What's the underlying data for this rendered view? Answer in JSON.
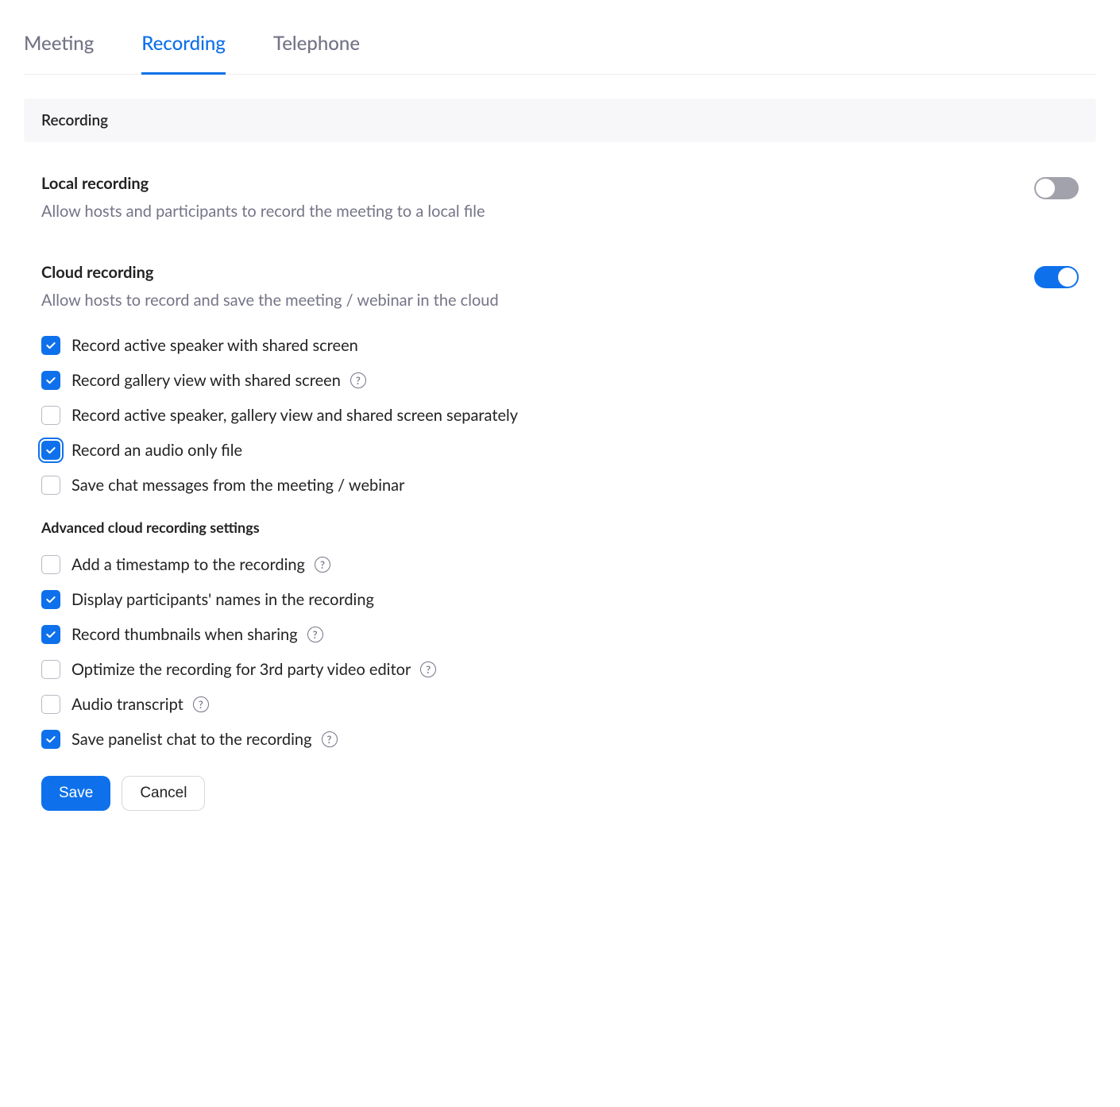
{
  "tabs": {
    "meeting": "Meeting",
    "recording": "Recording",
    "telephone": "Telephone"
  },
  "section_title": "Recording",
  "local": {
    "title": "Local recording",
    "desc": "Allow hosts and participants to record the meeting to a local file",
    "enabled": false
  },
  "cloud": {
    "title": "Cloud recording",
    "desc": "Allow hosts to record and save the meeting / webinar in the cloud",
    "enabled": true,
    "options": [
      {
        "label": "Record active speaker with shared screen",
        "checked": true,
        "help": false,
        "focus": false
      },
      {
        "label": "Record gallery view with shared screen",
        "checked": true,
        "help": true,
        "focus": false
      },
      {
        "label": "Record active speaker, gallery view and shared screen separately",
        "checked": false,
        "help": false,
        "focus": false
      },
      {
        "label": "Record an audio only file",
        "checked": true,
        "help": false,
        "focus": true
      },
      {
        "label": "Save chat messages from the meeting / webinar",
        "checked": false,
        "help": false,
        "focus": false
      }
    ]
  },
  "advanced": {
    "title": "Advanced cloud recording settings",
    "options": [
      {
        "label": "Add a timestamp to the recording",
        "checked": false,
        "help": true
      },
      {
        "label": "Display participants' names in the recording",
        "checked": true,
        "help": false
      },
      {
        "label": "Record thumbnails when sharing",
        "checked": true,
        "help": true
      },
      {
        "label": "Optimize the recording for 3rd party video editor",
        "checked": false,
        "help": true
      },
      {
        "label": "Audio transcript",
        "checked": false,
        "help": true
      },
      {
        "label": "Save panelist chat to the recording",
        "checked": true,
        "help": true
      }
    ]
  },
  "buttons": {
    "save": "Save",
    "cancel": "Cancel"
  }
}
